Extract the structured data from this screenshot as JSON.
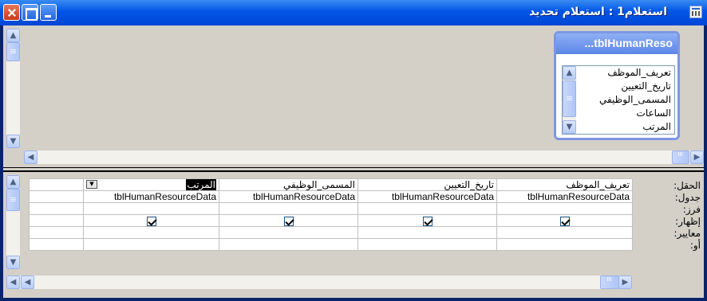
{
  "window": {
    "title": "استعلام1 : استعلام تحديد"
  },
  "table_box": {
    "title": "...tblHumanReso",
    "fields": [
      "تعريف_الموظف",
      "تاريخ_التعيين",
      "المسمى_الوظيفي",
      "الساعات",
      "المرتب"
    ]
  },
  "grid": {
    "row_labels": [
      "الحقل:",
      "جدول:",
      "فرز:",
      "إظهار:",
      "معايير:",
      "أو:"
    ],
    "columns": [
      {
        "field": "تعريف_الموظف",
        "table": "tblHumanResourceData",
        "show": true
      },
      {
        "field": "تاريخ_التعيين",
        "table": "tblHumanResourceData",
        "show": true
      },
      {
        "field": "المسمى_الوظيفي",
        "table": "tblHumanResourceData",
        "show": true
      },
      {
        "field": "المرتب",
        "table": "tblHumanResourceData",
        "show": true
      }
    ]
  },
  "icons": {
    "close": "close-icon",
    "maximize": "maximize-icon",
    "minimize": "minimize-icon",
    "dropdown": "chevron-down-icon"
  },
  "colors": {
    "title_bar": "#0055e5",
    "panel": "#d4d0c8",
    "table_box_border": "#7c97e2"
  }
}
